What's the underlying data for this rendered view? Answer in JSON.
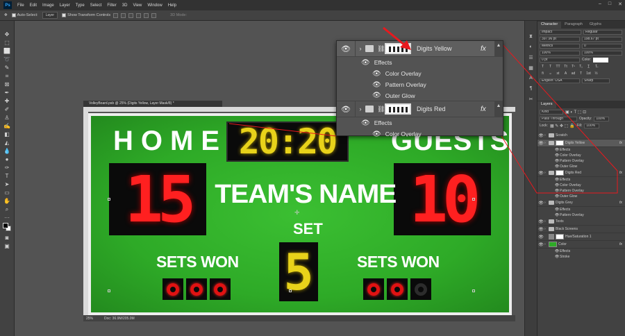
{
  "menubar": {
    "logo": "Ps",
    "items": [
      "File",
      "Edit",
      "Image",
      "Layer",
      "Type",
      "Select",
      "Filter",
      "3D",
      "View",
      "Window",
      "Help"
    ]
  },
  "options": {
    "auto_select_label": "Auto-Select:",
    "auto_select_value": "Layer",
    "transform_label": "Show Transform Controls",
    "mode_3d": "3D Mode:"
  },
  "document": {
    "tab_title": "VolleyBoard.psb @ 25% (Digits Yellow, Layer Mask/8) *",
    "zoom": "25%",
    "doc_size": "Doc: 36.9M/205.0M"
  },
  "scoreboard": {
    "home": "HOME",
    "guests": "GUESTS",
    "team_name": "TEAM'S NAME",
    "clock": "20:20",
    "home_score": "15",
    "guest_score": "10",
    "set_label": "SET",
    "set_value": "5",
    "sets_won_left": "SETS WON",
    "sets_won_right": "SETS WON"
  },
  "character_panel": {
    "tabs": [
      "Character",
      "Paragraph",
      "Glyphs"
    ],
    "font_family": "Impact",
    "font_style": "Regular",
    "font_size": "397.96 pt",
    "leading": "198.67 pt",
    "kerning": "Metrics",
    "tracking": "0",
    "vscale": "100%",
    "hscale": "100%",
    "baseline": "0 pt",
    "color_label": "Color:",
    "language": "English: USA",
    "antialias": "Sharp"
  },
  "layers_panel": {
    "title": "Layers",
    "kind": "Kind",
    "blend": "Pass Through",
    "opacity_label": "Opacity:",
    "opacity": "100%",
    "lock_label": "Lock:",
    "fill_label": "Fill:",
    "fill": "100%",
    "rows": [
      {
        "name": "Scratch",
        "type": "folder",
        "fx": false
      },
      {
        "name": "Digits Yellow",
        "type": "group-mask",
        "fx": true,
        "selected": true
      },
      {
        "name": "Effects",
        "type": "sub"
      },
      {
        "name": "Color Overlay",
        "type": "sub"
      },
      {
        "name": "Pattern Overlay",
        "type": "sub"
      },
      {
        "name": "Outer Glow",
        "type": "sub"
      },
      {
        "name": "Digits Red",
        "type": "group-mask",
        "fx": true
      },
      {
        "name": "Effects",
        "type": "sub"
      },
      {
        "name": "Color Overlay",
        "type": "sub"
      },
      {
        "name": "Pattern Overlay",
        "type": "sub"
      },
      {
        "name": "Outer Glow",
        "type": "sub"
      },
      {
        "name": "Digits Grey",
        "type": "folder",
        "fx": true
      },
      {
        "name": "Effects",
        "type": "sub"
      },
      {
        "name": "Pattern Overlay",
        "type": "sub"
      },
      {
        "name": "Texts",
        "type": "folder",
        "fx": false
      },
      {
        "name": "Black Screens",
        "type": "folder",
        "fx": false
      },
      {
        "name": "Hue/Saturation 1",
        "type": "adjust",
        "fx": false
      },
      {
        "name": "Color",
        "type": "fill",
        "fx": true
      },
      {
        "name": "Effects",
        "type": "sub"
      },
      {
        "name": "Stroke",
        "type": "sub"
      }
    ]
  },
  "zoom_panel": {
    "layer1": "Digits Yellow",
    "layer1_effects": [
      "Effects",
      "Color Overlay",
      "Pattern Overlay",
      "Outer Glow"
    ],
    "layer2": "Digits Red",
    "layer2_effects": [
      "Effects",
      "Color Overlay"
    ],
    "fx": "fx"
  },
  "colors": {
    "accent_arrow": "#e8191e",
    "board_green": "#2eaa27",
    "digit_yellow": "#e8d21a",
    "digit_red": "#ff2020"
  }
}
